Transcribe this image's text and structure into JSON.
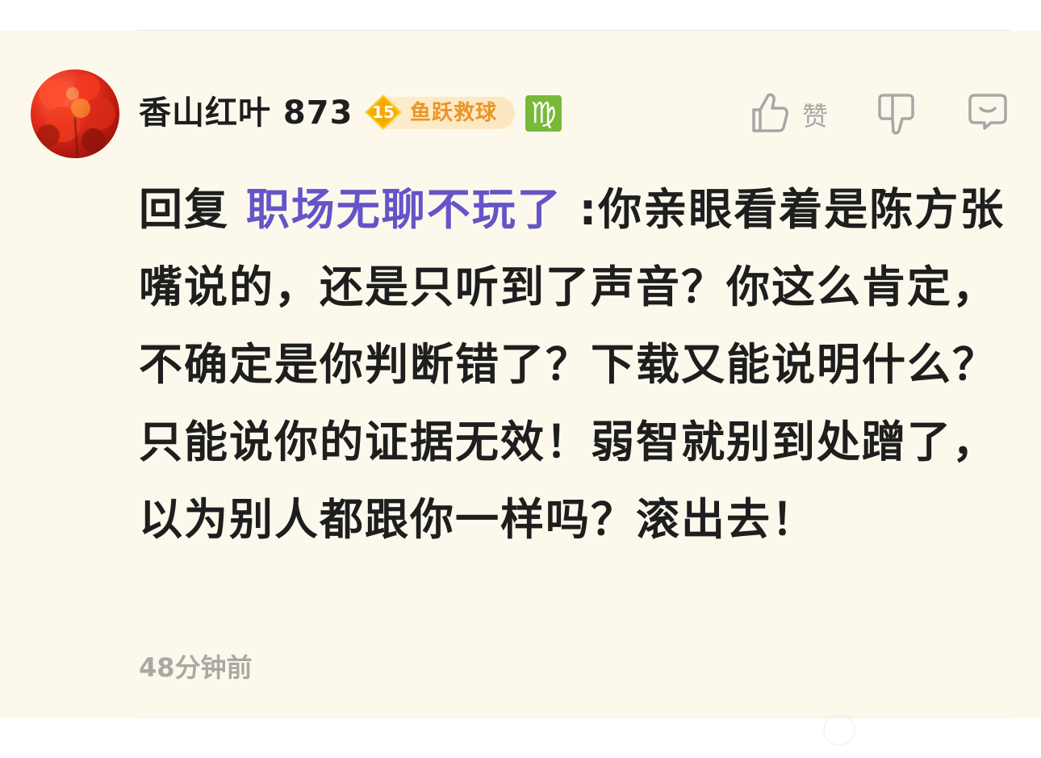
{
  "comment": {
    "author": {
      "username": "香山红叶 873",
      "level": "15",
      "medal_name": "鱼跃救球",
      "zodiac_symbol": "♍"
    },
    "actions": {
      "like_label": "赞"
    },
    "reply_prefix": "回复 ",
    "reply_target": "职场无聊不玩了",
    "text": " :你亲眼看着是陈方张嘴说的，还是只听到了声音？你这么肯定，不确定是你判断错了？下载又能说明什么？只能说你的证据无效！弱智就别到处蹭了，以为别人都跟你一样吗？滚出去！",
    "timestamp": "48分钟前"
  },
  "colors": {
    "card_background": "#fcf9ec",
    "reply_target": "#6554c8",
    "medal_text": "#e9952a",
    "level_diamond": "#f2b400",
    "zodiac_badge": "#79b93a",
    "icon_gray": "#a7a7a7"
  },
  "icons": [
    "thumbs-up-icon",
    "thumbs-down-icon",
    "reply-bubble-icon",
    "level-diamond-icon",
    "virgo-zodiac-icon"
  ]
}
